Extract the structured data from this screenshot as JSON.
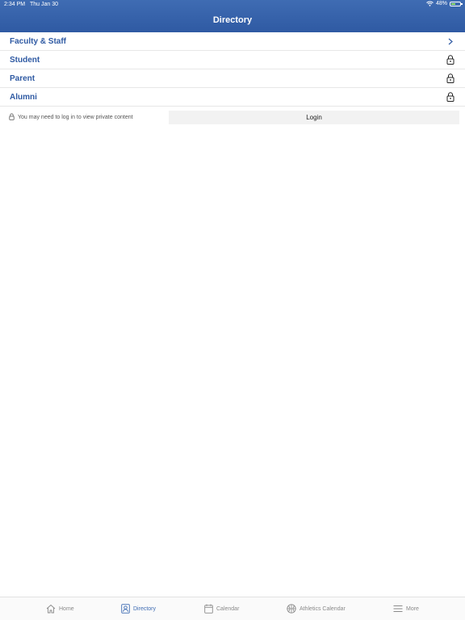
{
  "status_bar": {
    "time": "2:34 PM",
    "date": "Thu Jan 30",
    "battery": "48%",
    "battery_level": 0.48,
    "wifi_icon": "wifi-icon",
    "battery_icon": "battery-icon"
  },
  "header": {
    "title": "Directory"
  },
  "rows": [
    {
      "label": "Faculty & Staff",
      "icon": "chevron-right-icon"
    },
    {
      "label": "Student",
      "icon": "lock-icon"
    },
    {
      "label": "Parent",
      "icon": "lock-icon"
    },
    {
      "label": "Alumni",
      "icon": "lock-icon"
    }
  ],
  "login": {
    "note": "You may need to log in to view private content",
    "button_label": "Login"
  },
  "tabs": [
    {
      "label": "Home",
      "icon": "home-icon",
      "active": false
    },
    {
      "label": "Directory",
      "icon": "directory-icon",
      "active": true
    },
    {
      "label": "Calendar",
      "icon": "calendar-icon",
      "active": false
    },
    {
      "label": "Athletics Calendar",
      "icon": "basketball-icon",
      "active": false
    },
    {
      "label": "More",
      "icon": "menu-icon",
      "active": false
    }
  ],
  "colors": {
    "header": "#2f5aa3",
    "accent": "#3f6cb3",
    "inactive_tab": "#8a8a8a"
  }
}
